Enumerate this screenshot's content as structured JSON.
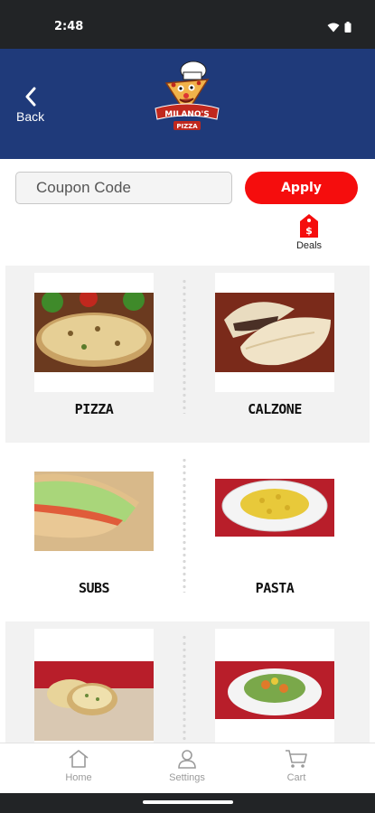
{
  "status_bar": {
    "time": "2:48"
  },
  "header": {
    "back_label": "Back",
    "logo_text": "MILANO'S",
    "logo_subtext": "PIZZA",
    "color": "#1f3a7a"
  },
  "coupon": {
    "placeholder": "Coupon Code",
    "value": ""
  },
  "apply_label": "Apply",
  "deals_label": "Deals",
  "categories": [
    {
      "label": "PIZZA",
      "icon": "pizza-photo"
    },
    {
      "label": "CALZONE",
      "icon": "calzone-photo"
    },
    {
      "label": "SUBS",
      "icon": "sub-sandwich-photo"
    },
    {
      "label": "PASTA",
      "icon": "pasta-photo"
    },
    {
      "label": "",
      "icon": "garlic-bread-photo"
    },
    {
      "label": "",
      "icon": "vegetable-dish-photo"
    }
  ],
  "tabbar": {
    "home": "Home",
    "settings": "Settings",
    "cart": "Cart"
  },
  "colors": {
    "accent": "#f50d0d",
    "brand": "#1f3a7a",
    "tab_inactive": "#9a9a9a"
  }
}
